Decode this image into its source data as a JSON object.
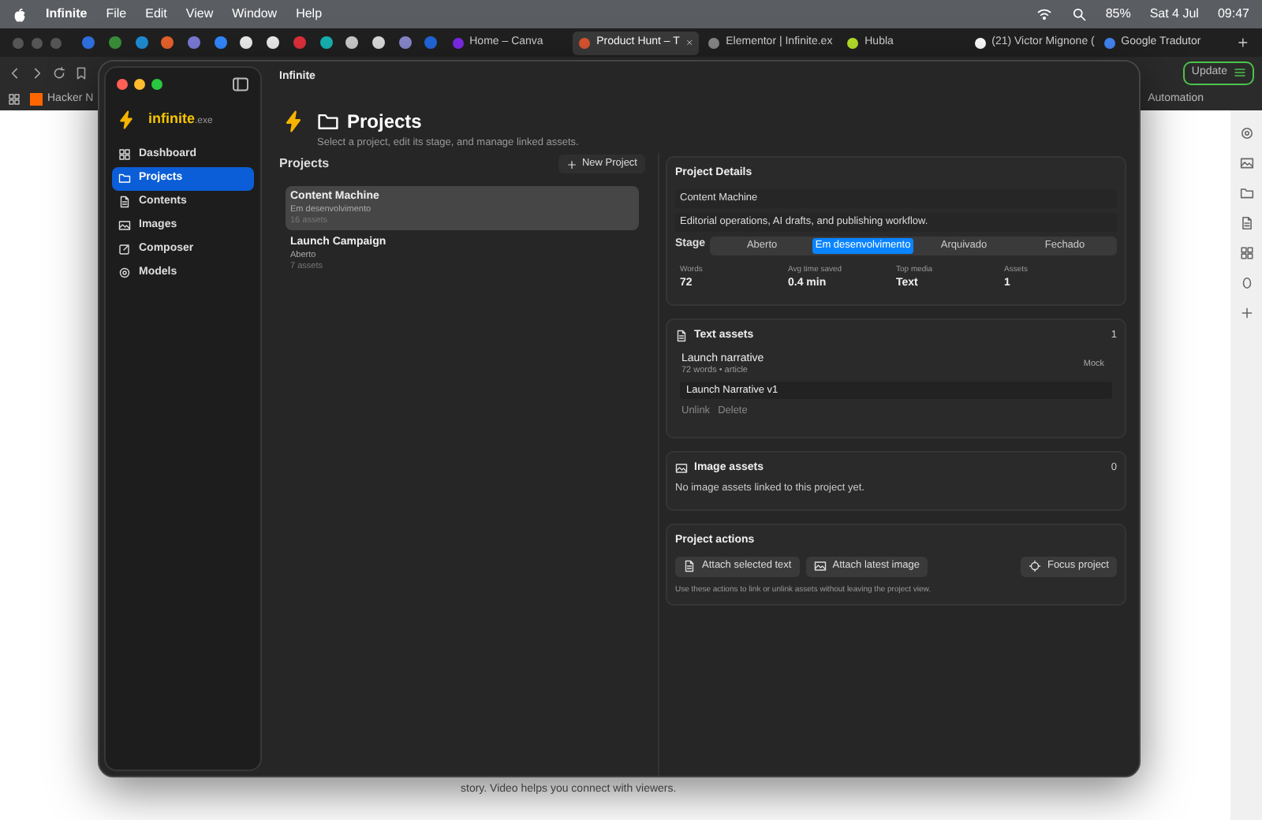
{
  "menubar": {
    "app": "Infinite",
    "menus": [
      "File",
      "Edit",
      "View",
      "Window",
      "Help"
    ],
    "battery": "85%",
    "date": "Sat 4 Jul",
    "time": "09:47"
  },
  "browser": {
    "tabs": [
      {
        "title": "Home – Canva",
        "selected": false
      },
      {
        "title": "Product Hunt – T",
        "selected": true
      },
      {
        "title": "Elementor | Infinite.ex",
        "selected": false
      },
      {
        "title": "Hubla",
        "selected": false
      },
      {
        "title": "(21) Victor Mignone (",
        "selected": false
      },
      {
        "title": "Google Tradutor",
        "selected": false
      }
    ],
    "update_button": "Update",
    "bookmarks": [
      "Hacker N",
      "Automation"
    ],
    "page_text": "story. Video helps you connect with viewers."
  },
  "app": {
    "window_title": "Infinite",
    "brand": {
      "name": "infinite",
      "suffix": ".exe"
    },
    "nav": [
      {
        "label": "Dashboard",
        "selected": false
      },
      {
        "label": "Projects",
        "selected": true
      },
      {
        "label": "Contents",
        "selected": false
      },
      {
        "label": "Images",
        "selected": false
      },
      {
        "label": "Composer",
        "selected": false
      },
      {
        "label": "Models",
        "selected": false
      }
    ],
    "header": {
      "title": "Projects",
      "subtitle": "Select a project, edit its stage, and manage linked assets."
    },
    "list": {
      "heading": "Projects",
      "new_button": "New Project",
      "projects": [
        {
          "name": "Content Machine",
          "stage": "Em desenvolvimento",
          "assets": "16 assets",
          "selected": true
        },
        {
          "name": "Launch Campaign",
          "stage": "Aberto",
          "assets": "7 assets",
          "selected": false
        }
      ]
    },
    "details": {
      "heading": "Project Details",
      "name": "Content Machine",
      "description": "Editorial operations, AI drafts, and publishing workflow.",
      "stage_label": "Stage",
      "stages": [
        {
          "label": "Aberto",
          "selected": false
        },
        {
          "label": "Em desenvolvimento",
          "selected": true
        },
        {
          "label": "Arquivado",
          "selected": false
        },
        {
          "label": "Fechado",
          "selected": false
        }
      ],
      "stats": [
        {
          "label": "Words",
          "value": "72"
        },
        {
          "label": "Avg time saved",
          "value": "0.4 min"
        },
        {
          "label": "Top media",
          "value": "Text"
        },
        {
          "label": "Assets",
          "value": "1"
        }
      ]
    },
    "text_assets": {
      "title": "Text assets",
      "count": "1",
      "items": [
        {
          "title": "Launch narrative",
          "meta": "72 words • article",
          "badge": "Mock",
          "version": "Launch Narrative v1",
          "actions": [
            "Unlink",
            "Delete"
          ]
        }
      ]
    },
    "image_assets": {
      "title": "Image assets",
      "count": "0",
      "empty": "No image assets linked to this project yet."
    },
    "actions": {
      "title": "Project actions",
      "buttons": [
        "Attach selected text",
        "Attach latest image",
        "Focus project"
      ],
      "note": "Use these actions to link or unlink assets without leaving the project view."
    }
  }
}
